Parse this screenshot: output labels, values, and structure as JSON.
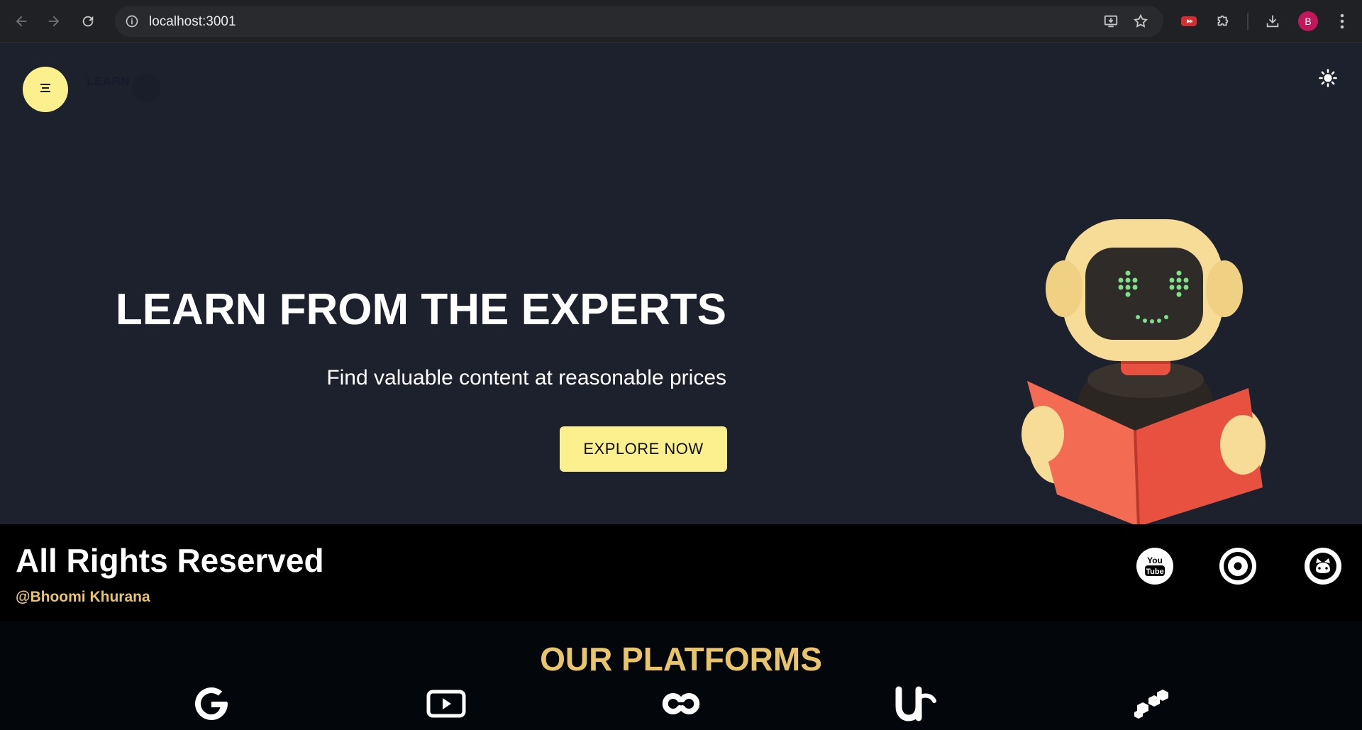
{
  "browser": {
    "url": "localhost:3001",
    "profile_initial": "B",
    "icons": [
      "back-arrow-icon",
      "forward-arrow-icon",
      "reload-icon",
      "site-info-icon",
      "install-app-icon",
      "bookmark-star-icon",
      "extension-red-icon",
      "extensions-puzzle-icon",
      "download-icon",
      "more-vert-icon"
    ]
  },
  "header": {
    "logo_text": "LEARN",
    "menu_icon": "menu-lines-icon",
    "theme_icon": "sun-icon"
  },
  "hero": {
    "title": "LEARN FROM THE EXPERTS",
    "subtitle": "Find valuable content at reasonable prices",
    "cta_label": "EXPLORE NOW",
    "illustration": "robot-reading-book-icon"
  },
  "footer": {
    "title": "All Rights Reserved",
    "handle": "@Bhoomi Khurana",
    "social": [
      {
        "name": "youtube-icon",
        "label": "You Tube"
      },
      {
        "name": "face-smile-icon",
        "label": ""
      },
      {
        "name": "github-icon",
        "label": ""
      }
    ]
  },
  "platforms": {
    "title": "OUR PLATFORMS",
    "items": [
      "google-icon",
      "youtube-play-icon",
      "coursera-icon",
      "udemy-icon",
      "blocks-icon"
    ]
  },
  "colors": {
    "accent_yellow": "#fbef8e",
    "gold": "#e9c46a",
    "hero_bg": "#1d212e",
    "footer_bg": "#000000"
  }
}
